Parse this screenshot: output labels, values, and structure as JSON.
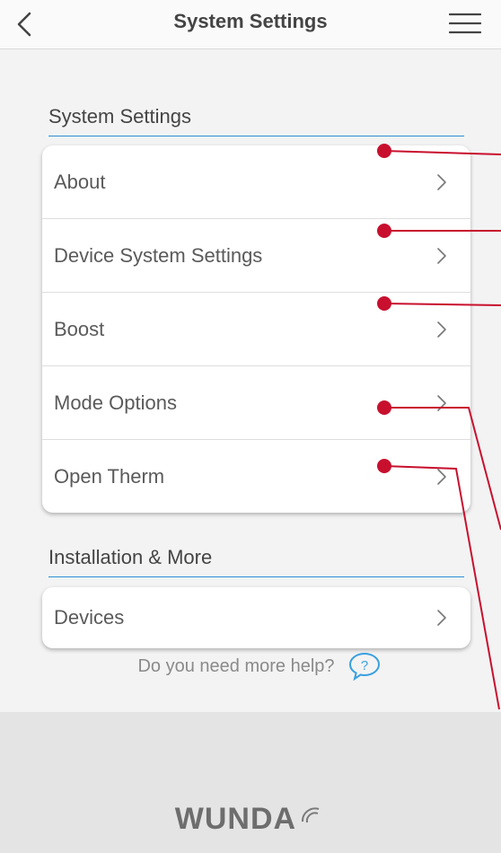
{
  "nav": {
    "title": "System Settings",
    "back_icon": "chevron-left-icon",
    "menu_icon": "hamburger-menu-icon"
  },
  "system_settings": {
    "title": "System Settings",
    "items": [
      {
        "label": "About"
      },
      {
        "label": "Device System Settings"
      },
      {
        "label": "Boost"
      },
      {
        "label": "Mode Options"
      },
      {
        "label": "Open Therm"
      }
    ]
  },
  "installation": {
    "title": "Installation & More",
    "items": [
      {
        "label": "Devices"
      }
    ]
  },
  "help": {
    "text": "Do you need more help?",
    "icon": "question-bubble-icon"
  },
  "footer": {
    "logo_text": "WUNDA"
  },
  "colors": {
    "accent_line": "#2b8fd6",
    "annotation": "#c8102e",
    "help_icon": "#3aa0e0"
  }
}
